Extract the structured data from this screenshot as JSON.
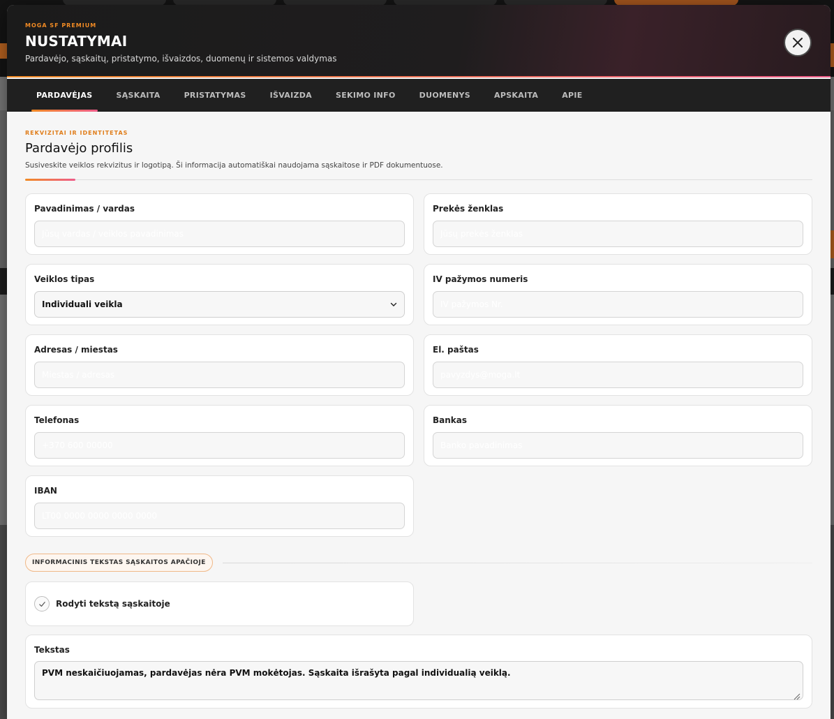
{
  "header": {
    "kicker": "MOGA SF PREMIUM",
    "title": "NUSTATYMAI",
    "subtitle": "Pardavėjo, sąskaitų, pristatymo, išvaizdos, duomenų ir sistemos valdymas",
    "close_icon": "close-icon"
  },
  "tabs": [
    {
      "label": "PARDAVĖJAS",
      "active": true
    },
    {
      "label": "SĄSKAITA",
      "active": false
    },
    {
      "label": "PRISTATYMAS",
      "active": false
    },
    {
      "label": "IŠVAIZDA",
      "active": false
    },
    {
      "label": "SEKIMO INFO",
      "active": false
    },
    {
      "label": "DUOMENYS",
      "active": false
    },
    {
      "label": "APSKAITA",
      "active": false
    },
    {
      "label": "APIE",
      "active": false
    }
  ],
  "section": {
    "kicker": "REKVIZITAI IR IDENTITETAS",
    "title": "Pardavėjo profilis",
    "description": "Susiveskite veiklos rekvizitus ir logotipą. Ši informacija automatiškai naudojama sąskaitose ir PDF dokumentuose."
  },
  "fields": {
    "name": {
      "label": "Pavadinimas / vardas",
      "placeholder": "Jūsų vardas / veiklos pavadinimas",
      "value": ""
    },
    "brand": {
      "label": "Prekės ženklas",
      "placeholder": "Jūsų prekės ženklas",
      "value": ""
    },
    "business_type": {
      "label": "Veiklos tipas",
      "value": "Individuali veikla"
    },
    "iv_number": {
      "label": "IV pažymos numeris",
      "placeholder": "IV pažymos Nr.",
      "value": ""
    },
    "address": {
      "label": "Adresas / miestas",
      "placeholder": "Miestas / adresas",
      "value": ""
    },
    "email": {
      "label": "El. paštas",
      "placeholder": "pavyzdys@moga.lt",
      "value": ""
    },
    "phone": {
      "label": "Telefonas",
      "placeholder": "+370 600 00000",
      "value": ""
    },
    "bank": {
      "label": "Bankas",
      "placeholder": "Banko pavadinimas",
      "value": ""
    },
    "iban": {
      "label": "IBAN",
      "placeholder": "LT00 0000 0000 0000 0000",
      "value": ""
    }
  },
  "info_text": {
    "chip": "INFORMACINIS TEKSTAS SĄSKAITOS APAČIOJE",
    "show_label": "Rodyti tekstą sąskaitoje",
    "show_checked": true,
    "text_label": "Tekstas",
    "text_value": "PVM neskaičiuojamas, pardavėjas nėra PVM mokėtojas. Sąskaita išrašyta pagal individualią veiklą."
  },
  "colors": {
    "accent_orange": "#f08a24",
    "accent_pink": "#ef5d8a",
    "header_bg": "#1b1b1b",
    "tab_bar_bg": "#202020"
  }
}
